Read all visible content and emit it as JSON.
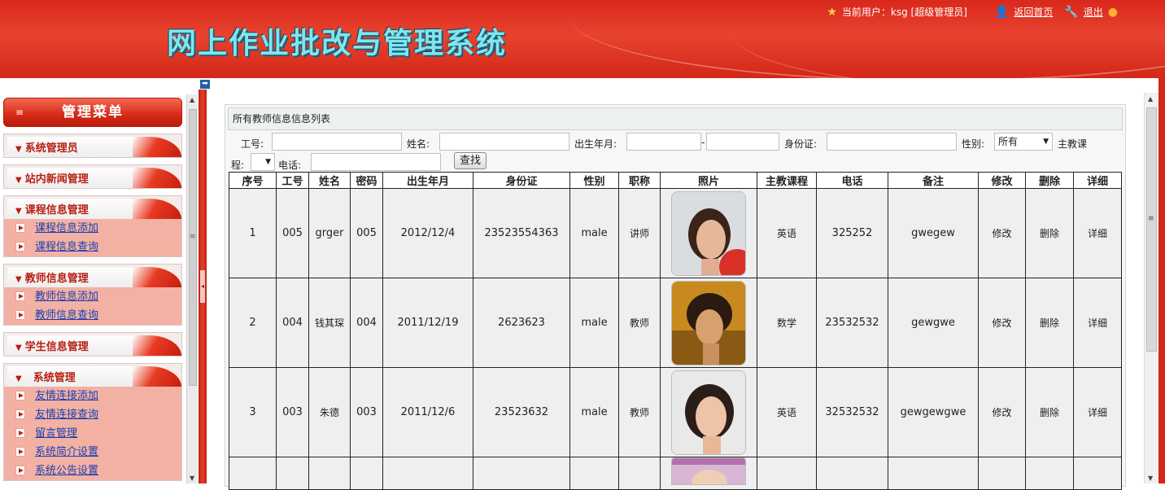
{
  "header": {
    "title": "网上作业批改与管理系统",
    "current_user": "当前用户：ksg [超级管理员]",
    "home_link": "返回首页",
    "logout_link": "退出"
  },
  "sidebar": {
    "menu_title": "管理菜单",
    "groups": [
      {
        "label": "系统管理员",
        "items": []
      },
      {
        "label": "站内新闻管理",
        "items": []
      },
      {
        "label": "课程信息管理",
        "items": [
          "课程信息添加",
          "课程信息查询"
        ]
      },
      {
        "label": "教师信息管理",
        "items": [
          "教师信息添加",
          "教师信息查询"
        ]
      },
      {
        "label": "学生信息管理",
        "items": []
      },
      {
        "label": "系统管理",
        "items": [
          "友情连接添加",
          "友情连接查询",
          "留言管理",
          "系统简介设置",
          "系统公告设置"
        ]
      }
    ]
  },
  "panel": {
    "title": "所有教师信息信息列表"
  },
  "search": {
    "id_label": "工号:",
    "name_label": "姓名:",
    "birth_label": "出生年月:",
    "birth_sep": "-",
    "idcard_label": "身份证:",
    "gender_label": "性别:",
    "gender_value": "所有",
    "course_label_a": "主教课",
    "course_label_b": "程:",
    "phone_label": "电话:",
    "search_button": "查找"
  },
  "table": {
    "headers": [
      "序号",
      "工号",
      "姓名",
      "密码",
      "出生年月",
      "身份证",
      "性别",
      "职称",
      "照片",
      "主教课程",
      "电话",
      "备注",
      "修改",
      "删除",
      "详细"
    ],
    "rows": [
      {
        "no": "1",
        "id": "005",
        "name": "grger",
        "pwd": "005",
        "birth": "2012/12/4",
        "idcard": "23523554363",
        "gender": "male",
        "title": "讲师",
        "course": "英语",
        "phone": "325252",
        "note": "gwegew",
        "edit": "修改",
        "del": "删除",
        "detail": "详细"
      },
      {
        "no": "2",
        "id": "004",
        "name": "钱其琛",
        "pwd": "004",
        "birth": "2011/12/19",
        "idcard": "2623623",
        "gender": "male",
        "title": "教师",
        "course": "数学",
        "phone": "23532532",
        "note": "gewgwe",
        "edit": "修改",
        "del": "删除",
        "detail": "详细"
      },
      {
        "no": "3",
        "id": "003",
        "name": "朱德",
        "pwd": "003",
        "birth": "2011/12/6",
        "idcard": "23523632",
        "gender": "male",
        "title": "教师",
        "course": "英语",
        "phone": "32532532",
        "note": "gewgewgwe",
        "edit": "修改",
        "del": "删除",
        "detail": "详细"
      }
    ]
  },
  "colors": {
    "header_red": "#d9281c",
    "title_cyan": "#7fe6ee",
    "link_blue": "#1a3fb0"
  }
}
